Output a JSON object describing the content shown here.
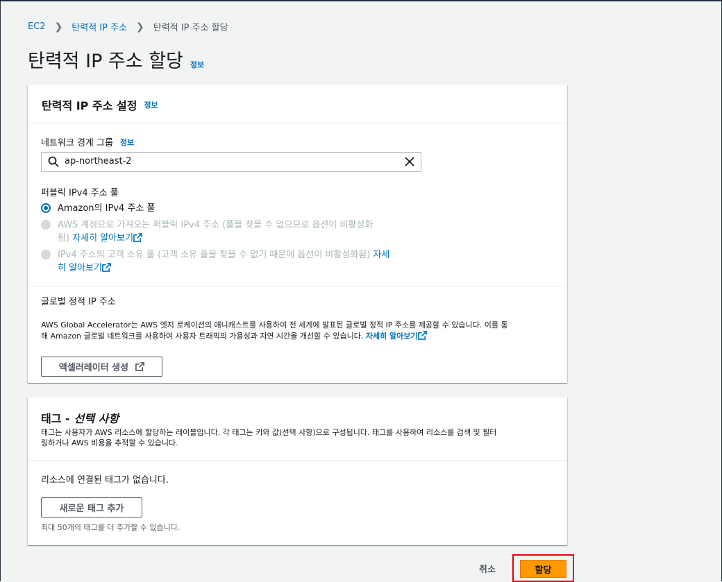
{
  "breadcrumb": {
    "root": "EC2",
    "parent": "탄력적 IP 주소",
    "current": "탄력적 IP 주소 할당"
  },
  "page": {
    "title": "탄력적 IP 주소 할당",
    "info": "정보"
  },
  "settings": {
    "title": "탄력적 IP 주소 설정",
    "info": "정보",
    "network_group_label": "네트워크 경계 그룹",
    "network_group_info": "정보",
    "network_group_value": "ap-northeast-2",
    "pool_label": "퍼블릭 IPv4 주소 풀",
    "pool_options": [
      {
        "line1": "Amazon의 IPv4 주소 풀",
        "selected": true
      },
      {
        "line1": "AWS 계정으로 가져오는 퍼블릭 IPv4 주소 (풀을 찾을 수 없으므로 옵션이 비활성화",
        "line2": "됨)",
        "link": "자세히 알아보기"
      },
      {
        "line1": "IPv4 주소의 고객 소유 풀 (고객 소유 풀을 찾을 수 없기 때문에 옵션이 비활성화됨)",
        "link1": "자세",
        "link2": "히 알아보기"
      }
    ],
    "global_title": "글로벌 정적 IP 주소",
    "global_desc1": "AWS Global Accelerator는 AWS 엣지 로케이션의 애니캐스트를 사용하여 전 세계에 발표된 글로벌 정적 IP 주소를 제공할 수 있습니다. 이를 통",
    "global_desc2": "해 Amazon 글로벌 네트워크를 사용하여 사용자 트래픽의 가용성과 지연 시간을 개선할 수 있습니다.",
    "global_link": "자세히 알아보기",
    "accelerator_button": "액셀러레이터 생성"
  },
  "tags": {
    "title_main": "태그 -",
    "title_optional": "선택 사항",
    "desc1": "태그는 사용자가 AWS 리소스에 할당하는 레이블입니다. 각 태그는 키와 값(선택 사항)으로 구성됩니다. 태그를 사용하여 리소스를 검색 및 필터",
    "desc2": "링하거나 AWS 비용을 추적할 수 있습니다.",
    "empty": "리소스에 연결된 태그가 없습니다.",
    "add_button": "새로운 태그 추가",
    "limit": "최대 50개의 태그를 더 추가할 수 있습니다."
  },
  "footer": {
    "cancel": "취소",
    "submit": "할당"
  }
}
